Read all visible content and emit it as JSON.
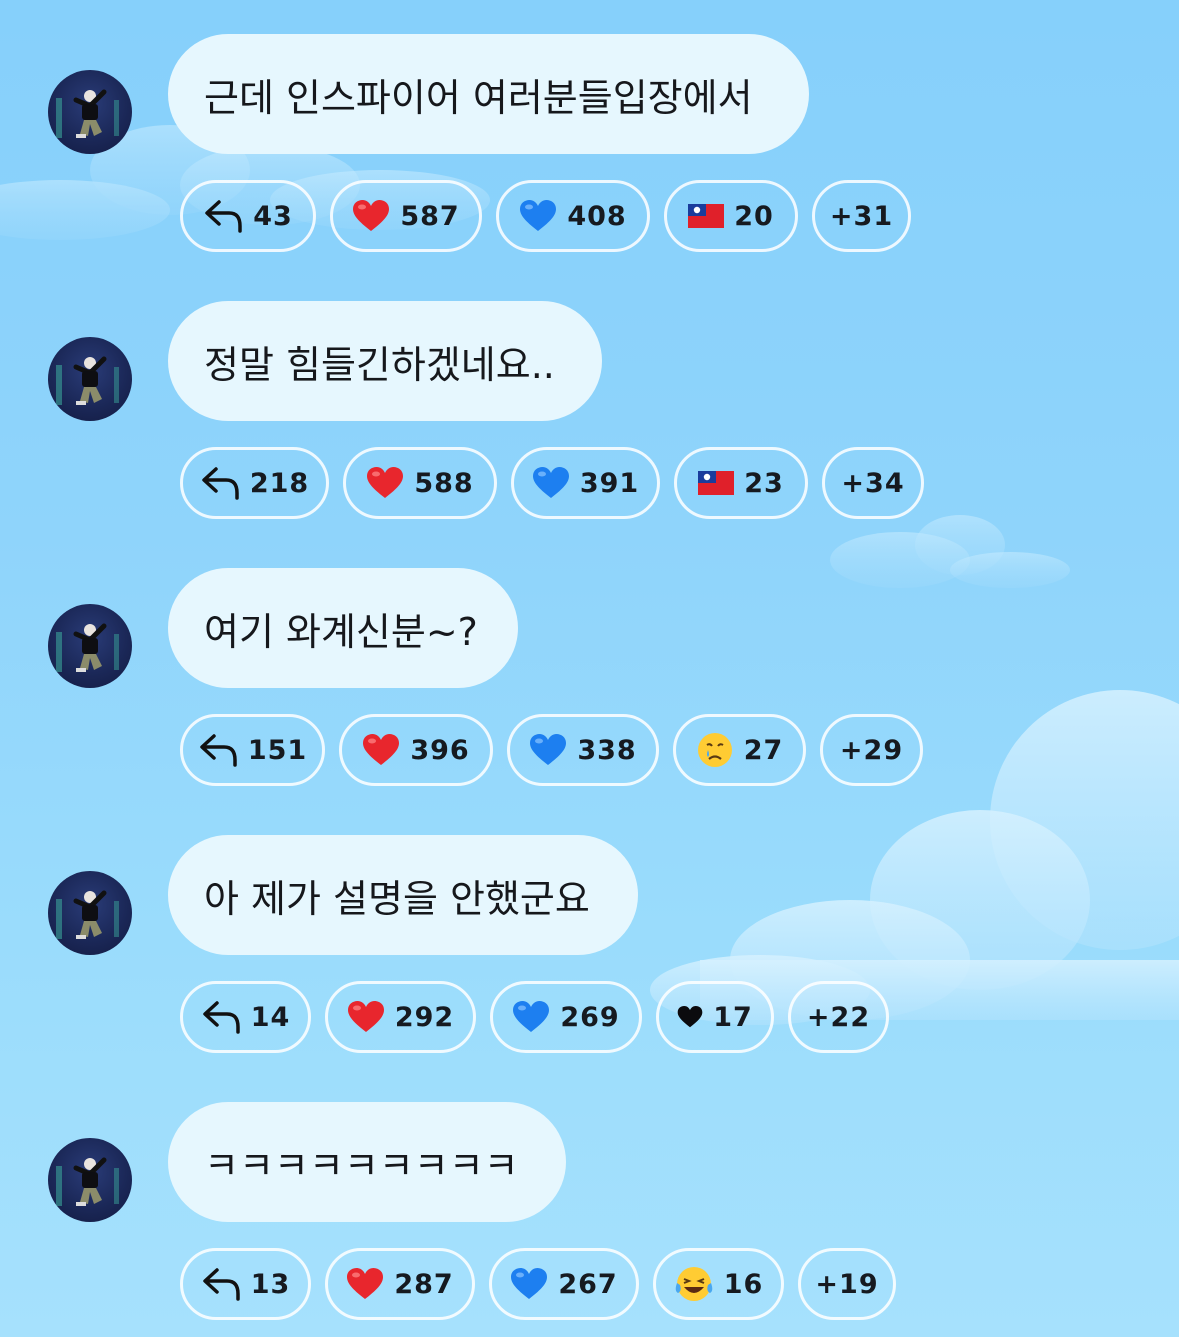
{
  "colors": {
    "background": "#8fd4fb",
    "bubble": "#e6f7fe",
    "pill_border": "#ffffff",
    "red_heart": "#e8262d",
    "blue_heart": "#1d7ff0"
  },
  "messages": [
    {
      "text": "근데 인스파이어 여러분들입장에서",
      "reactions": [
        {
          "icon": "reply-arrow-icon",
          "count": "43"
        },
        {
          "icon": "red-heart-icon",
          "count": "587"
        },
        {
          "icon": "blue-heart-icon",
          "count": "408"
        },
        {
          "icon": "taiwan-flag-icon",
          "count": "20"
        },
        {
          "icon": "none",
          "count": "+31"
        }
      ]
    },
    {
      "text": "정말 힘들긴하겠네요..",
      "reactions": [
        {
          "icon": "reply-arrow-icon",
          "count": "218"
        },
        {
          "icon": "red-heart-icon",
          "count": "588"
        },
        {
          "icon": "blue-heart-icon",
          "count": "391"
        },
        {
          "icon": "taiwan-flag-icon",
          "count": "23"
        },
        {
          "icon": "none",
          "count": "+34"
        }
      ]
    },
    {
      "text": "여기 와계신분~?",
      "reactions": [
        {
          "icon": "reply-arrow-icon",
          "count": "151"
        },
        {
          "icon": "red-heart-icon",
          "count": "396"
        },
        {
          "icon": "blue-heart-icon",
          "count": "338"
        },
        {
          "icon": "crying-face-icon",
          "count": "27"
        },
        {
          "icon": "none",
          "count": "+29"
        }
      ]
    },
    {
      "text": "아 제가 설명을 안했군요",
      "reactions": [
        {
          "icon": "reply-arrow-icon",
          "count": "14"
        },
        {
          "icon": "red-heart-icon",
          "count": "292"
        },
        {
          "icon": "blue-heart-icon",
          "count": "269"
        },
        {
          "icon": "black-heart-icon",
          "count": "17"
        },
        {
          "icon": "none",
          "count": "+22"
        }
      ]
    },
    {
      "text": "ㅋㅋㅋㅋㅋㅋㅋㅋㅋ",
      "reactions": [
        {
          "icon": "reply-arrow-icon",
          "count": "13"
        },
        {
          "icon": "red-heart-icon",
          "count": "287"
        },
        {
          "icon": "blue-heart-icon",
          "count": "267"
        },
        {
          "icon": "laughing-tears-icon",
          "count": "16"
        },
        {
          "icon": "none",
          "count": "+19"
        }
      ]
    }
  ]
}
